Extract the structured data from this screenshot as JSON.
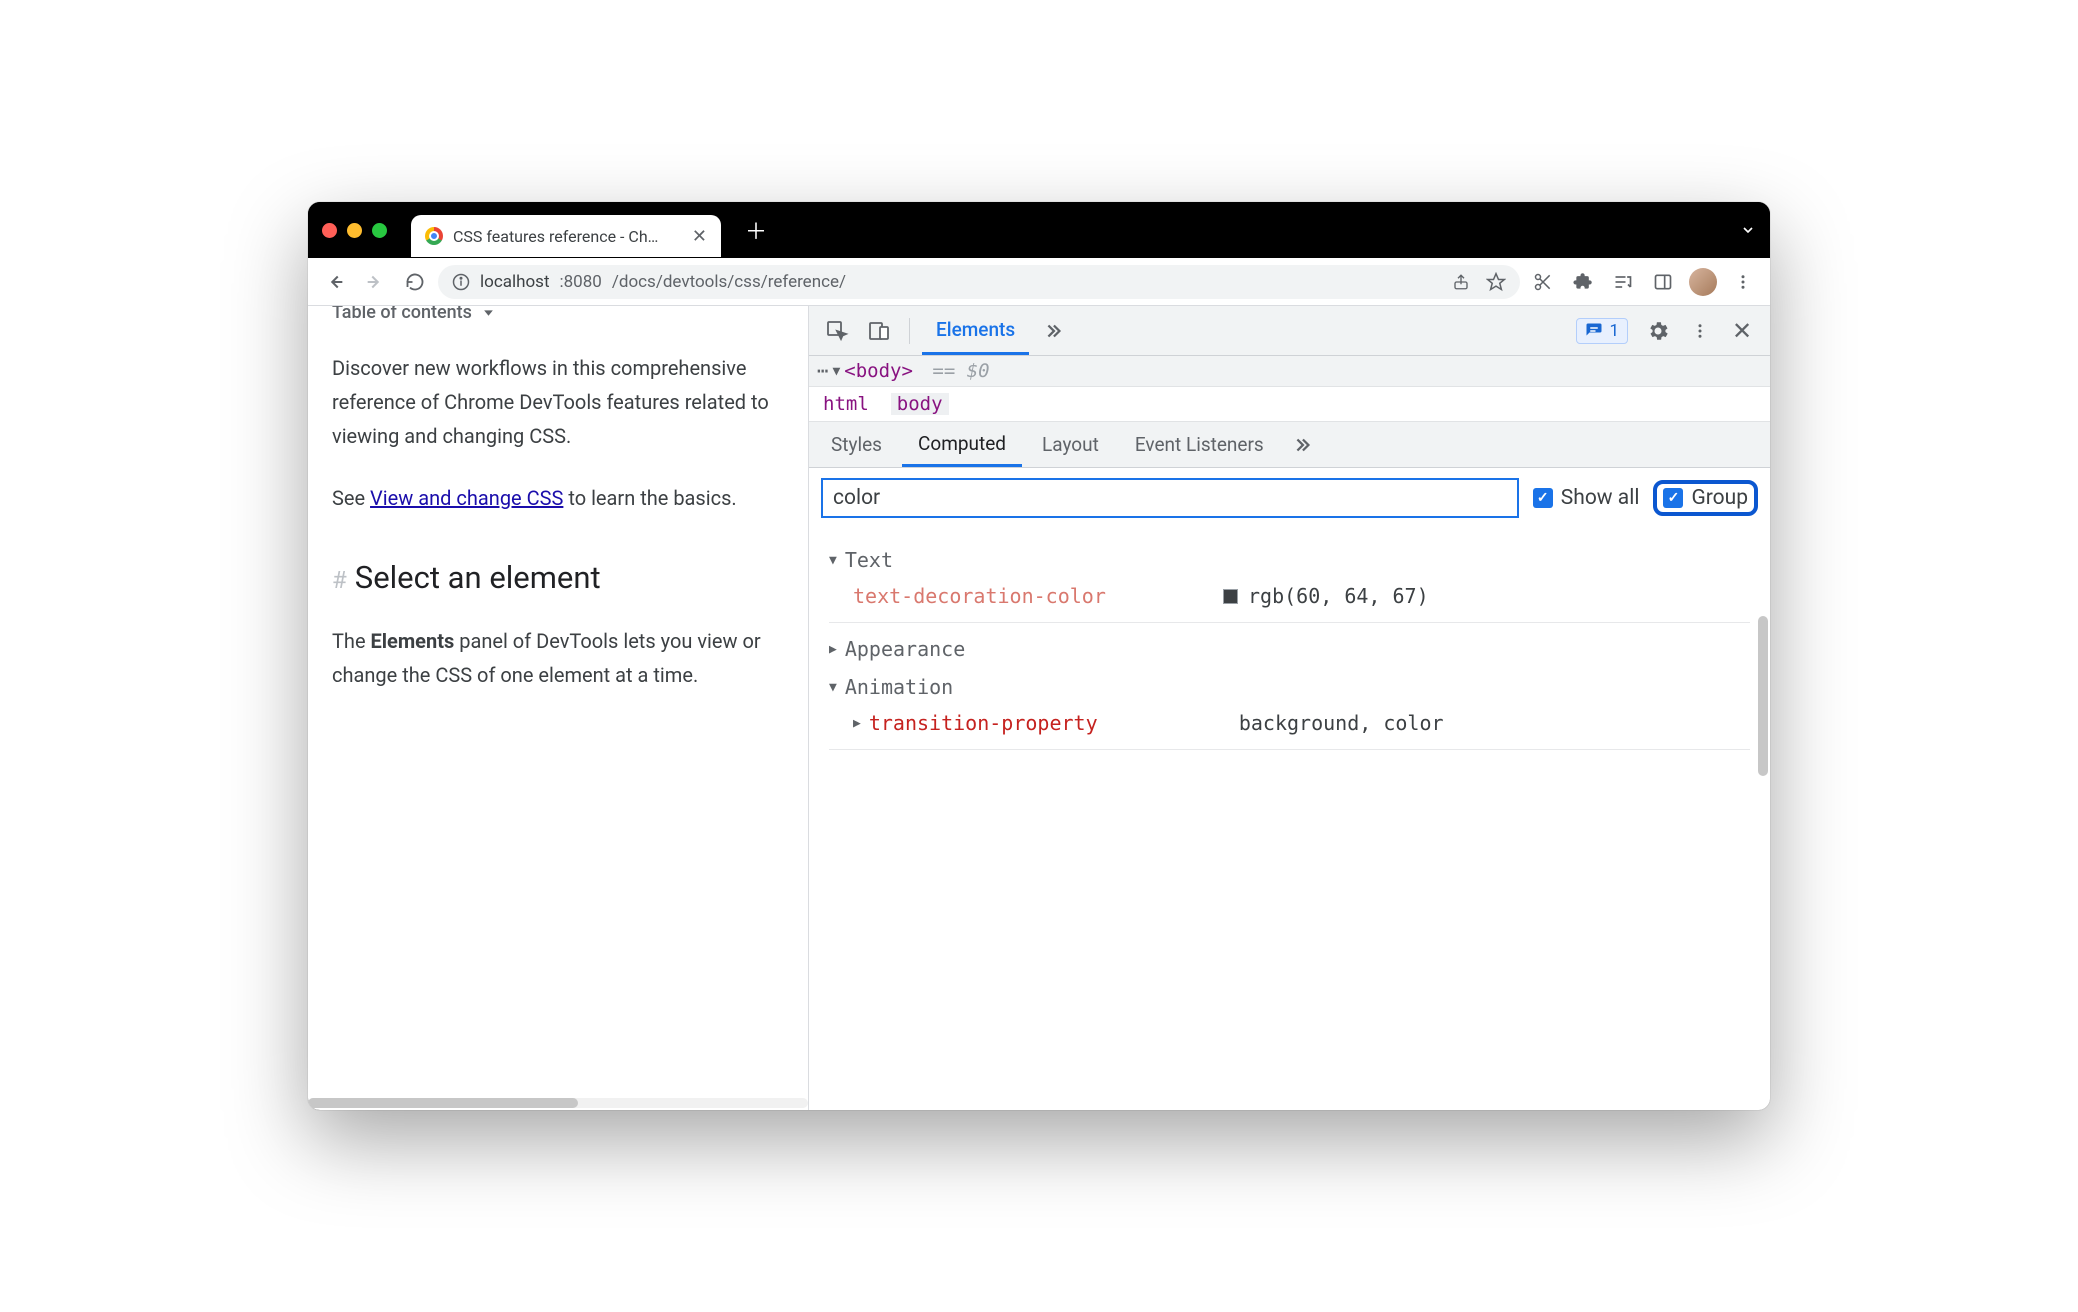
{
  "tab": {
    "title": "CSS features reference - Chrom"
  },
  "address": {
    "host": "localhost",
    "port": ":8080",
    "path": "/docs/devtools/css/reference/"
  },
  "page": {
    "toc": "Table of contents",
    "intro": "Discover new workflows in this comprehensive reference of Chrome DevTools features related to viewing and changing CSS.",
    "see": "See ",
    "link": "View and change CSS",
    "see_after": " to learn the basics.",
    "heading": "Select an element",
    "body_para_pre": "The ",
    "body_para_bold": "Elements",
    "body_para_post": " panel of DevTools lets you view or change the CSS of one element at a time."
  },
  "devtools": {
    "top_tab": "Elements",
    "issues_count": "1",
    "dom": {
      "tag": "<body>",
      "eq": "== $0",
      "dots": "⋯"
    },
    "crumbs": [
      "html",
      "body"
    ],
    "subtabs": [
      "Styles",
      "Computed",
      "Layout",
      "Event Listeners"
    ],
    "filter_value": "color",
    "show_all_label": "Show all",
    "group_label": "Group",
    "groups": [
      {
        "name": "Text",
        "expanded": true,
        "props": [
          {
            "name": "text-decoration-color",
            "value": "rgb(60, 64, 67)",
            "swatch": true,
            "nameClass": "salmon"
          }
        ]
      },
      {
        "name": "Appearance",
        "expanded": false,
        "props": []
      },
      {
        "name": "Animation",
        "expanded": true,
        "props": [
          {
            "name": "transition-property",
            "value": "background, color",
            "swatch": false,
            "nameClass": "red",
            "collapsedTri": true
          }
        ]
      }
    ]
  }
}
